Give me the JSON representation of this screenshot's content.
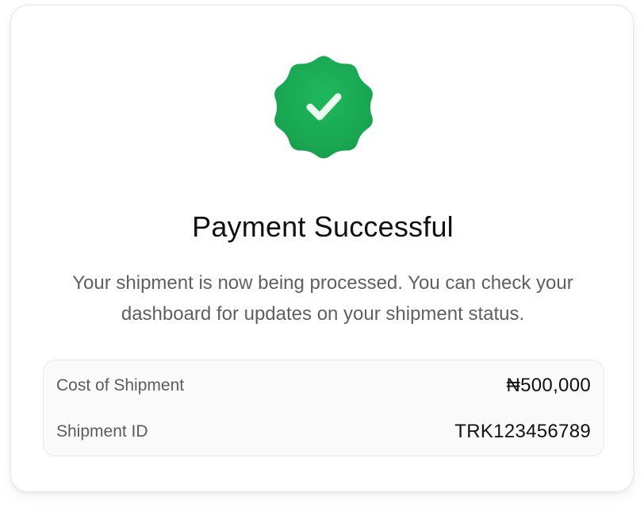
{
  "status": {
    "icon": "check-badge-icon",
    "color": "#1aa954",
    "title": "Payment Successful",
    "message": "Your shipment is now being processed. You can check your dashboard for updates on your shipment status."
  },
  "details": {
    "rows": [
      {
        "label": "Cost of Shipment",
        "value": "₦500,000"
      },
      {
        "label": "Shipment ID",
        "value": "TRK123456789"
      }
    ]
  }
}
